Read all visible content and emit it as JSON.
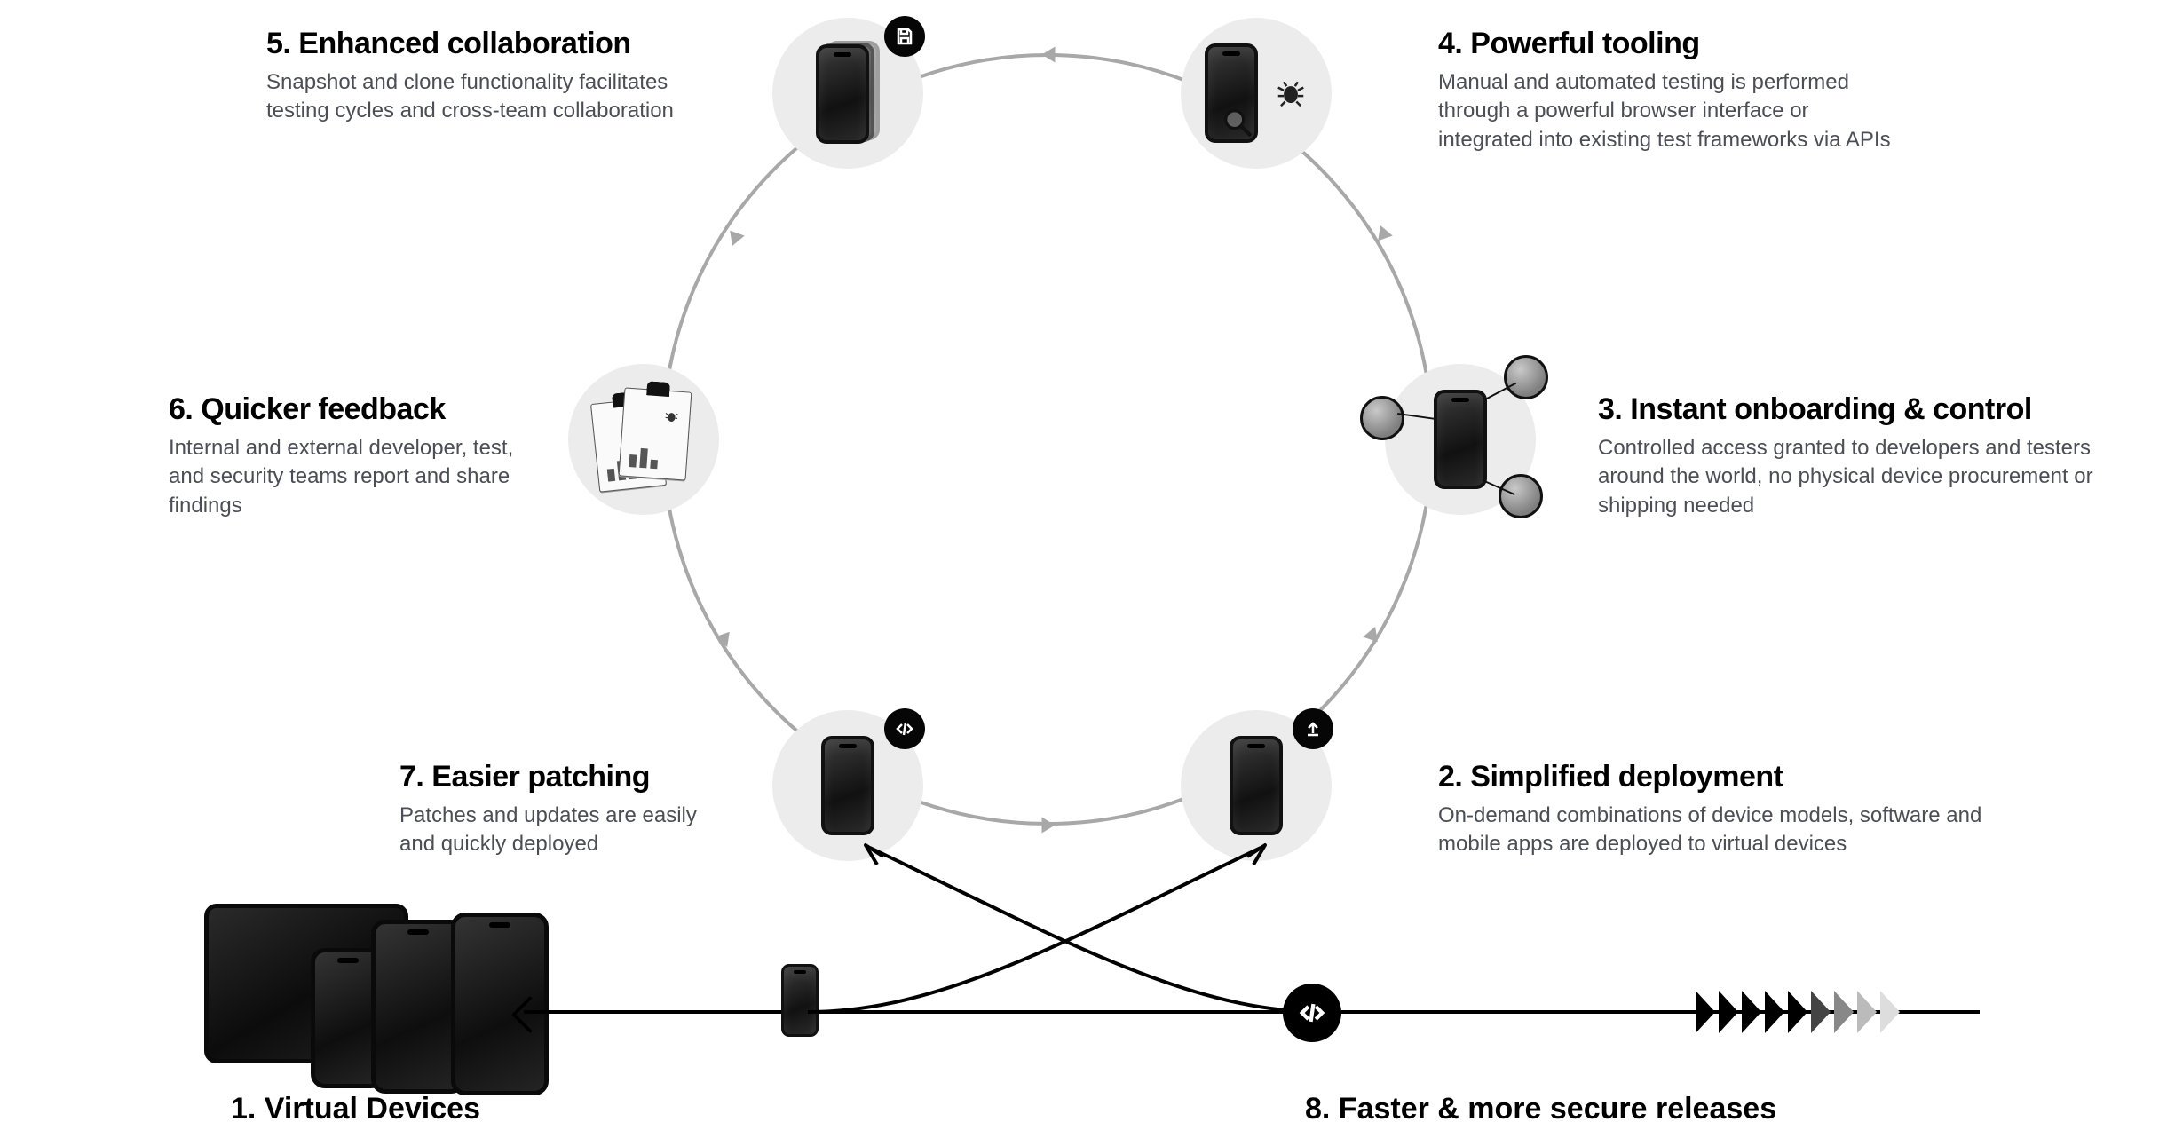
{
  "steps": {
    "s1": {
      "title": "1.  Virtual Devices",
      "desc": ""
    },
    "s2": {
      "title": "2. Simplified deployment",
      "desc": "On-demand combinations of device models, software and mobile apps are deployed to virtual devices"
    },
    "s3": {
      "title": "3. Instant onboarding & control",
      "desc": "Controlled access granted to developers and testers around the world, no physical device procurement or shipping needed"
    },
    "s4": {
      "title": "4. Powerful tooling",
      "desc": "Manual and automated testing is performed through a powerful browser interface or integrated into existing test frameworks via APIs"
    },
    "s5": {
      "title": "5. Enhanced collaboration",
      "desc": "Snapshot and clone functionality facilitates testing cycles and cross-team collaboration"
    },
    "s6": {
      "title": "6. Quicker feedback",
      "desc": "Internal and external developer, test, and security teams report and share findings"
    },
    "s7": {
      "title": "7. Easier patching",
      "desc": "Patches and updates are easily and quickly deployed"
    },
    "s8": {
      "title": "8. Faster & more secure releases",
      "desc": ""
    }
  }
}
